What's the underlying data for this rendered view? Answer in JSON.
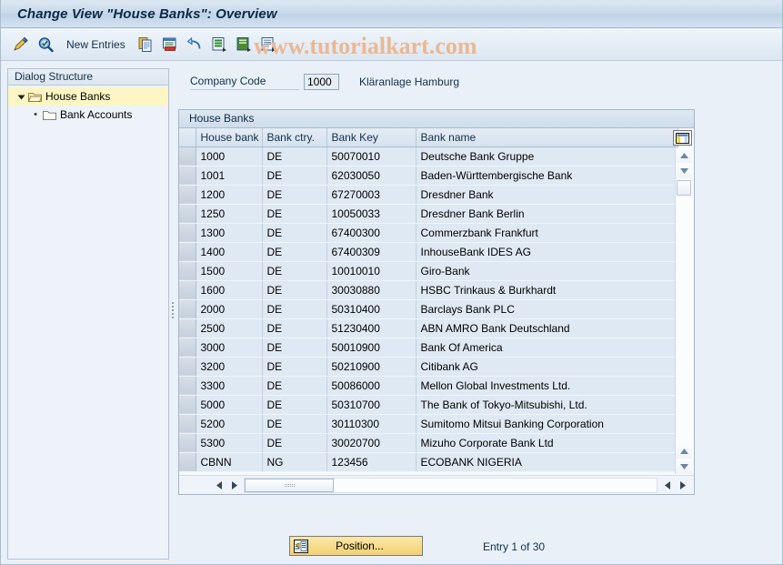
{
  "window": {
    "title": "Change View \"House Banks\": Overview"
  },
  "toolbar": {
    "icons": [
      {
        "name": "pencil-display-change-icon"
      },
      {
        "name": "magnifier-check-icon"
      }
    ],
    "new_entries_label": "New Entries",
    "action_icons": [
      {
        "name": "copy-as-icon"
      },
      {
        "name": "delete-icon"
      },
      {
        "name": "undo-icon"
      },
      {
        "name": "select-all-icon"
      },
      {
        "name": "deselect-all-icon"
      },
      {
        "name": "variant-icon"
      }
    ]
  },
  "watermark": {
    "text": "www.tutorialkart.com",
    "color": "#eab894"
  },
  "sidebar": {
    "header": "Dialog Structure",
    "items": [
      {
        "label": "House Banks",
        "icon": "open-folder-icon",
        "selected": true,
        "expander": "collapse-arrow-icon"
      },
      {
        "label": "Bank Accounts",
        "icon": "closed-folder-icon",
        "selected": false,
        "expander": "leaf-bullet-icon"
      }
    ]
  },
  "form": {
    "company_code_label": "Company Code",
    "company_code_value": "1000",
    "company_code_placeholder": "",
    "company_name": "Kläranlage Hamburg"
  },
  "panel": {
    "title": "House Banks"
  },
  "table": {
    "columns": [
      "House bank",
      "Bank ctry.",
      "Bank Key",
      "Bank name"
    ],
    "rows": [
      [
        "1000",
        "DE",
        "50070010",
        "Deutsche Bank Gruppe"
      ],
      [
        "1001",
        "DE",
        "62030050",
        "Baden-Württembergische Bank"
      ],
      [
        "1200",
        "DE",
        "67270003",
        "Dresdner Bank"
      ],
      [
        "1250",
        "DE",
        "10050033",
        "Dresdner Bank Berlin"
      ],
      [
        "1300",
        "DE",
        "67400300",
        "Commerzbank Frankfurt"
      ],
      [
        "1400",
        "DE",
        "67400309",
        "InhouseBank IDES AG"
      ],
      [
        "1500",
        "DE",
        "10010010",
        "Giro-Bank"
      ],
      [
        "1600",
        "DE",
        "30030880",
        "HSBC Trinkaus & Burkhardt"
      ],
      [
        "2000",
        "DE",
        "50310400",
        "Barclays Bank PLC"
      ],
      [
        "2500",
        "DE",
        "51230400",
        "ABN AMRO Bank Deutschland"
      ],
      [
        "3000",
        "DE",
        "50010900",
        "Bank Of America"
      ],
      [
        "3200",
        "DE",
        "50210900",
        "Citibank AG"
      ],
      [
        "3300",
        "DE",
        "50086000",
        "Mellon Global Investments Ltd."
      ],
      [
        "5000",
        "DE",
        "50310700",
        "The Bank of Tokyo-Mitsubishi, Ltd."
      ],
      [
        "5200",
        "DE",
        "30110300",
        "Sumitomo Mitsui Banking Corporation"
      ],
      [
        "5300",
        "DE",
        "30020700",
        "Mizuho Corporate Bank Ltd"
      ],
      [
        "CBNN",
        "NG",
        "123456",
        "ECOBANK NIGERIA"
      ]
    ]
  },
  "footer": {
    "position_button_label": "Position...",
    "entry_status": "Entry 1 of 30"
  }
}
